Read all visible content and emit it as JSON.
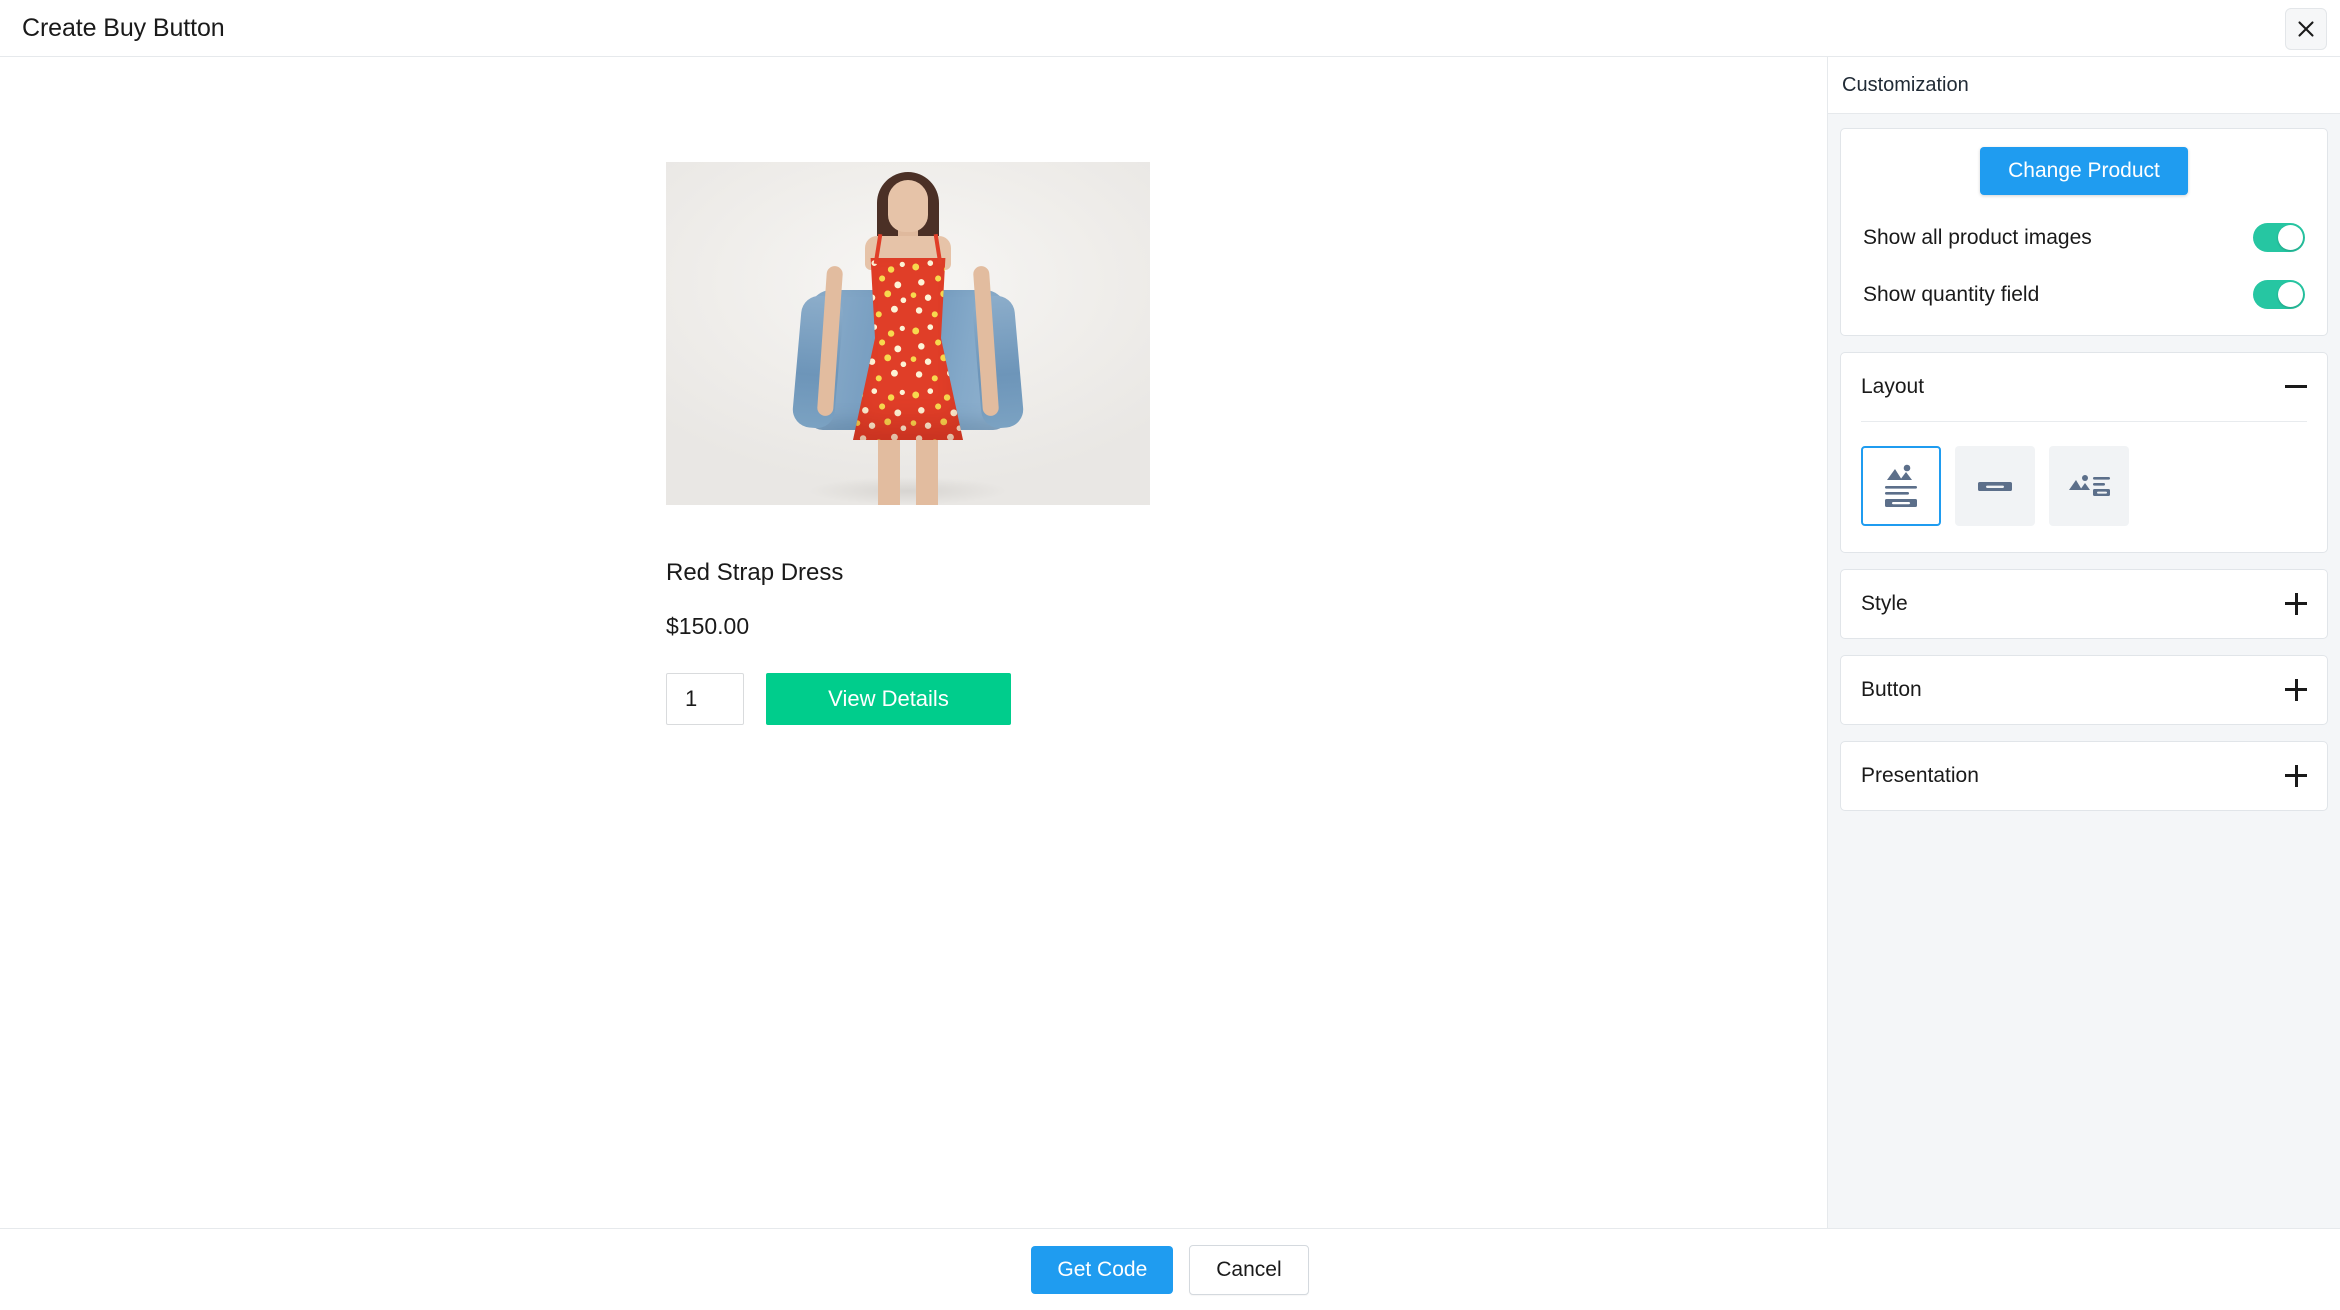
{
  "header": {
    "title": "Create Buy Button",
    "close_icon": "close-icon"
  },
  "preview": {
    "product_title": "Red Strap Dress",
    "product_price": "$150.00",
    "quantity_value": "1",
    "quantity_placeholder": "1",
    "buy_button_label": "View Details",
    "image_alt": "Model wearing red floral strap dress with denim jacket",
    "buy_button_color": "#00cd8c"
  },
  "customization": {
    "header_title": "Customization",
    "change_product_label": "Change Product",
    "change_product_color": "#1f9cf0",
    "toggles": [
      {
        "label": "Show all product images",
        "on": true,
        "color": "#26c6a2"
      },
      {
        "label": "Show quantity field",
        "on": true,
        "color": "#26c6a2"
      }
    ],
    "sections": [
      {
        "title": "Layout",
        "expanded": true,
        "icon": "minus-icon"
      },
      {
        "title": "Style",
        "expanded": false,
        "icon": "plus-icon"
      },
      {
        "title": "Button",
        "expanded": false,
        "icon": "plus-icon"
      },
      {
        "title": "Presentation",
        "expanded": false,
        "icon": "plus-icon"
      }
    ],
    "layout_options": [
      {
        "name": "layout-option-vertical-centered",
        "selected": true
      },
      {
        "name": "layout-option-button-only",
        "selected": false
      },
      {
        "name": "layout-option-horizontal",
        "selected": false
      }
    ],
    "selected_accent": "#1f9cf0"
  },
  "footer": {
    "primary_label": "Get Code",
    "secondary_label": "Cancel"
  }
}
